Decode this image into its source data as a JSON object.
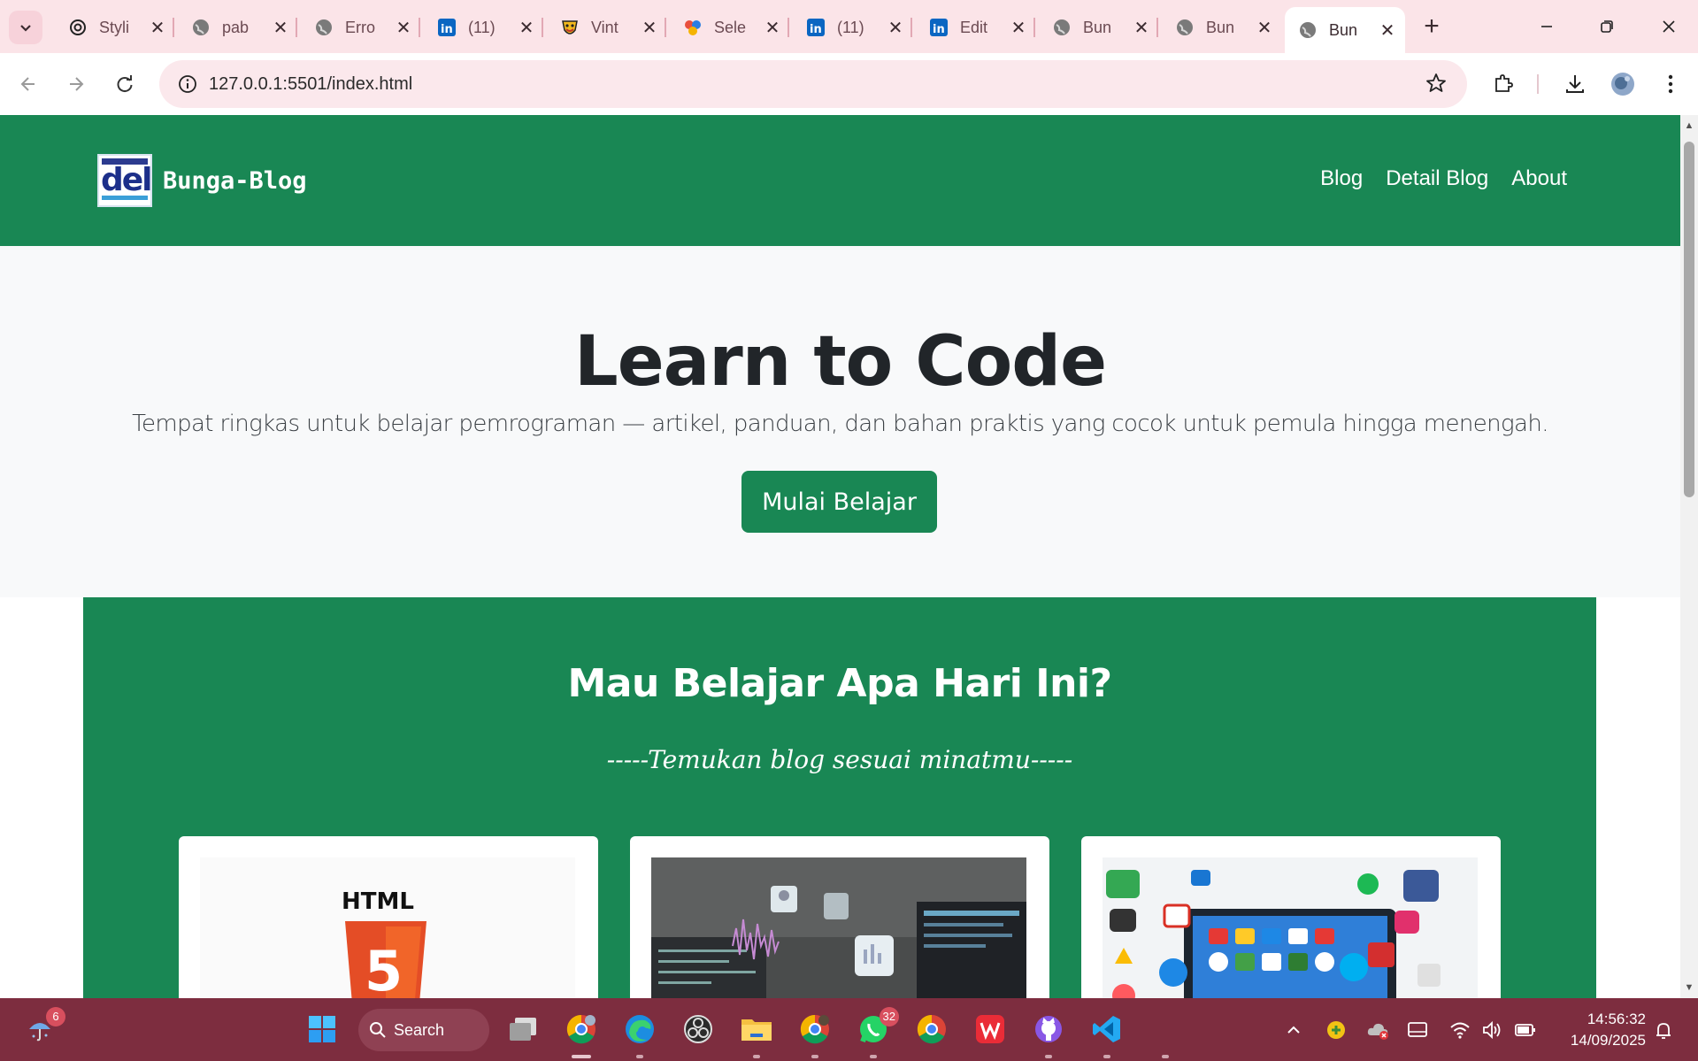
{
  "browser": {
    "tabs": [
      {
        "title": "Styli",
        "icon": "chatgpt-icon"
      },
      {
        "title": "pab",
        "icon": "globe-icon"
      },
      {
        "title": "Erro",
        "icon": "globe-icon"
      },
      {
        "title": "(11)",
        "icon": "linkedin-icon"
      },
      {
        "title": "Vint",
        "icon": "vinted-icon"
      },
      {
        "title": "Sele",
        "icon": "selector-icon"
      },
      {
        "title": "(11)",
        "icon": "linkedin-icon"
      },
      {
        "title": "Edit",
        "icon": "linkedin-icon"
      },
      {
        "title": "Bun",
        "icon": "globe-icon"
      },
      {
        "title": "Bun",
        "icon": "globe-icon"
      },
      {
        "title": "Bun",
        "icon": "globe-icon",
        "active": true
      }
    ],
    "url": "127.0.0.1:5501/index.html",
    "tab_close_glyph": "✕",
    "new_tab_glyph": "+"
  },
  "site": {
    "brand_name": "Bunga-Blog",
    "logo_text": "del",
    "nav_links": [
      "Blog",
      "Detail Blog",
      "About"
    ],
    "hero": {
      "title": "Learn to Code",
      "subtitle": "Tempat ringkas untuk belajar pemrograman — artikel, panduan, dan bahan praktis yang cocok untuk pemula hingga menengah.",
      "button": "Mulai Belajar"
    },
    "section": {
      "title": "Mau Belajar Apa Hari Ini?",
      "subtitle": "-----Temukan blog sesuai minatmu-----"
    },
    "cards": [
      {
        "image": "html5-logo",
        "label": "HTML",
        "badge": "5"
      },
      {
        "image": "coding-workspace-photo"
      },
      {
        "image": "app-icons-laptop-photo"
      }
    ]
  },
  "taskbar": {
    "weather_badge": "6",
    "search_label": "Search",
    "whatsapp_badge": "32",
    "time": "14:56:32",
    "date": "14/09/2025"
  },
  "colors": {
    "site_green": "#198754",
    "tab_strip": "#fbe4e8",
    "taskbar": "#7d2d3f"
  }
}
